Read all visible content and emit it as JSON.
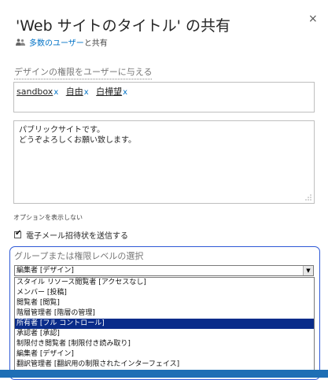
{
  "dialog": {
    "title": "'Web サイトのタイトル' の共有",
    "close_glyph": "×"
  },
  "shared": {
    "icon": "people-icon",
    "link_text": "多数のユーザー",
    "suffix_text": "と共有"
  },
  "invite": {
    "label": "デザインの権限をユーザーに与える",
    "people": [
      {
        "name": "sandbox",
        "remove": "x"
      },
      {
        "name": "自由",
        "remove": "x"
      },
      {
        "name": "白樺望",
        "remove": "x"
      }
    ]
  },
  "message": {
    "line1": "パブリックサイトです。",
    "line2": "どうぞよろしくお願い致します。"
  },
  "options": {
    "hide_label": "オプションを表示しない",
    "email_label": "電子メール招待状を送信する",
    "email_checked": true,
    "email_check_glyph": "✔"
  },
  "group": {
    "label": "グループまたは権限レベルの選択",
    "selected_value": "編集者 [デザイン]",
    "arrow_glyph": "▼",
    "options": [
      "スタイル リソース閲覧者 [アクセスなし]",
      "メンバー [投稿]",
      "閲覧者 [閲覧]",
      "階層管理者 [階層の管理]",
      "所有者 [フル コントロール]",
      "承認者 [承認]",
      "制限付き閲覧者 [制限付き読み取り]",
      "編集者 [デザイン]",
      "翻訳管理者 [翻訳用の制限されたインターフェイス]"
    ],
    "highlighted_index": 4
  },
  "colors": {
    "link": "#0072c6",
    "focus_border": "#2d58d6",
    "highlight": "#0a2c8a"
  }
}
